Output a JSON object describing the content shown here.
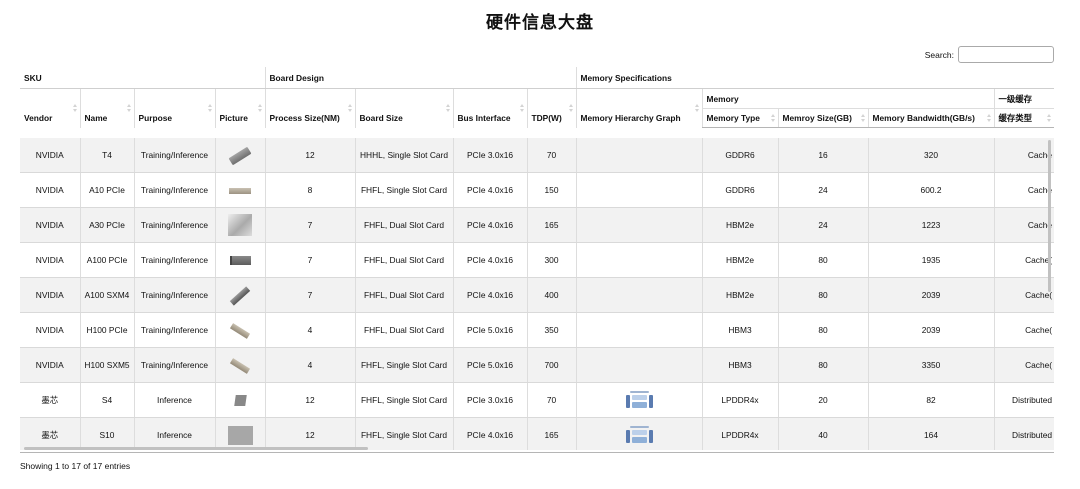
{
  "page": {
    "title": "硬件信息大盘",
    "search_label": "Search:",
    "search_value": "",
    "info": "Showing 1 to 17 of 17 entries"
  },
  "groups": {
    "sku": "SKU",
    "board_design": "Board Design",
    "memory_specifications": "Memory Specifications",
    "memory": "Memory",
    "l1_cache": "一级缓存"
  },
  "columns": {
    "vendor": "Vendor",
    "name": "Name",
    "purpose": "Purpose",
    "picture": "Picture",
    "process_size": "Process Size(NM)",
    "board_size": "Board Size",
    "bus_interface": "Bus Interface",
    "tdp": "TDP(W)",
    "memory_hierarchy_graph": "Memory Hierarchy Graph",
    "memory_type": "Memory Type",
    "memory_size": "Memroy Size(GB)",
    "memory_bandwidth": "Memory Bandwidth(GB/s)",
    "cache_type": "缓存类型"
  },
  "rows": [
    {
      "vendor": "NVIDIA",
      "name": "T4",
      "purpose": "Training/Inference",
      "picture_icon": "gpu-card-angled-image",
      "process": "12",
      "board": "HHHL, Single Slot Card",
      "bus": "PCIe 3.0x16",
      "tdp": "70",
      "graph_icon": "",
      "mem_type": "GDDR6",
      "mem_size": "16",
      "bandwidth": "320",
      "cache": "Cache"
    },
    {
      "vendor": "NVIDIA",
      "name": "A10 PCIe",
      "purpose": "Training/Inference",
      "picture_icon": "gpu-card-flat-image",
      "process": "8",
      "board": "FHFL, Single Slot Card",
      "bus": "PCIe 4.0x16",
      "tdp": "150",
      "graph_icon": "",
      "mem_type": "GDDR6",
      "mem_size": "24",
      "bandwidth": "600.2",
      "cache": "Cache"
    },
    {
      "vendor": "NVIDIA",
      "name": "A30 PCIe",
      "purpose": "Training/Inference",
      "picture_icon": "gpu-card-box-image",
      "process": "7",
      "board": "FHFL, Dual Slot Card",
      "bus": "PCIe 4.0x16",
      "tdp": "165",
      "graph_icon": "",
      "mem_type": "HBM2e",
      "mem_size": "24",
      "bandwidth": "1223",
      "cache": "Cache"
    },
    {
      "vendor": "NVIDIA",
      "name": "A100 PCIe",
      "purpose": "Training/Inference",
      "picture_icon": "gpu-card-bracket-image",
      "process": "7",
      "board": "FHFL, Dual Slot Card",
      "bus": "PCIe 4.0x16",
      "tdp": "300",
      "graph_icon": "",
      "mem_type": "HBM2e",
      "mem_size": "80",
      "bandwidth": "1935",
      "cache": "Cache("
    },
    {
      "vendor": "NVIDIA",
      "name": "A100 SXM4",
      "purpose": "Training/Inference",
      "picture_icon": "gpu-card-diagonal-image",
      "process": "7",
      "board": "FHFL, Dual Slot Card",
      "bus": "PCIe 4.0x16",
      "tdp": "400",
      "graph_icon": "",
      "mem_type": "HBM2e",
      "mem_size": "80",
      "bandwidth": "2039",
      "cache": "Cache("
    },
    {
      "vendor": "NVIDIA",
      "name": "H100 PCIe",
      "purpose": "Training/Inference",
      "picture_icon": "gpu-card-tilted-image",
      "process": "4",
      "board": "FHFL, Dual Slot Card",
      "bus": "PCIe 5.0x16",
      "tdp": "350",
      "graph_icon": "",
      "mem_type": "HBM3",
      "mem_size": "80",
      "bandwidth": "2039",
      "cache": "Cache("
    },
    {
      "vendor": "NVIDIA",
      "name": "H100 SXM5",
      "purpose": "Training/Inference",
      "picture_icon": "gpu-card-tilted-image",
      "process": "4",
      "board": "FHFL, Single Slot Card",
      "bus": "PCIe 5.0x16",
      "tdp": "700",
      "graph_icon": "",
      "mem_type": "HBM3",
      "mem_size": "80",
      "bandwidth": "3350",
      "cache": "Cache("
    },
    {
      "vendor": "墨芯",
      "name": "S4",
      "purpose": "Inference",
      "picture_icon": "chip-image",
      "process": "12",
      "board": "FHFL, Single Slot Card",
      "bus": "PCIe 3.0x16",
      "tdp": "70",
      "graph_icon": "memory-hierarchy-graph-image",
      "mem_type": "LPDDR4x",
      "mem_size": "20",
      "bandwidth": "82",
      "cache": "Distributed"
    },
    {
      "vendor": "墨芯",
      "name": "S10",
      "purpose": "Inference",
      "picture_icon": "card-photo-image",
      "process": "12",
      "board": "FHFL, Single Slot Card",
      "bus": "PCIe 4.0x16",
      "tdp": "165",
      "graph_icon": "memory-hierarchy-graph-image",
      "mem_type": "LPDDR4x",
      "mem_size": "40",
      "bandwidth": "164",
      "cache": "Distributed"
    }
  ],
  "icons": {
    "sort": "sort-arrows-icon"
  }
}
